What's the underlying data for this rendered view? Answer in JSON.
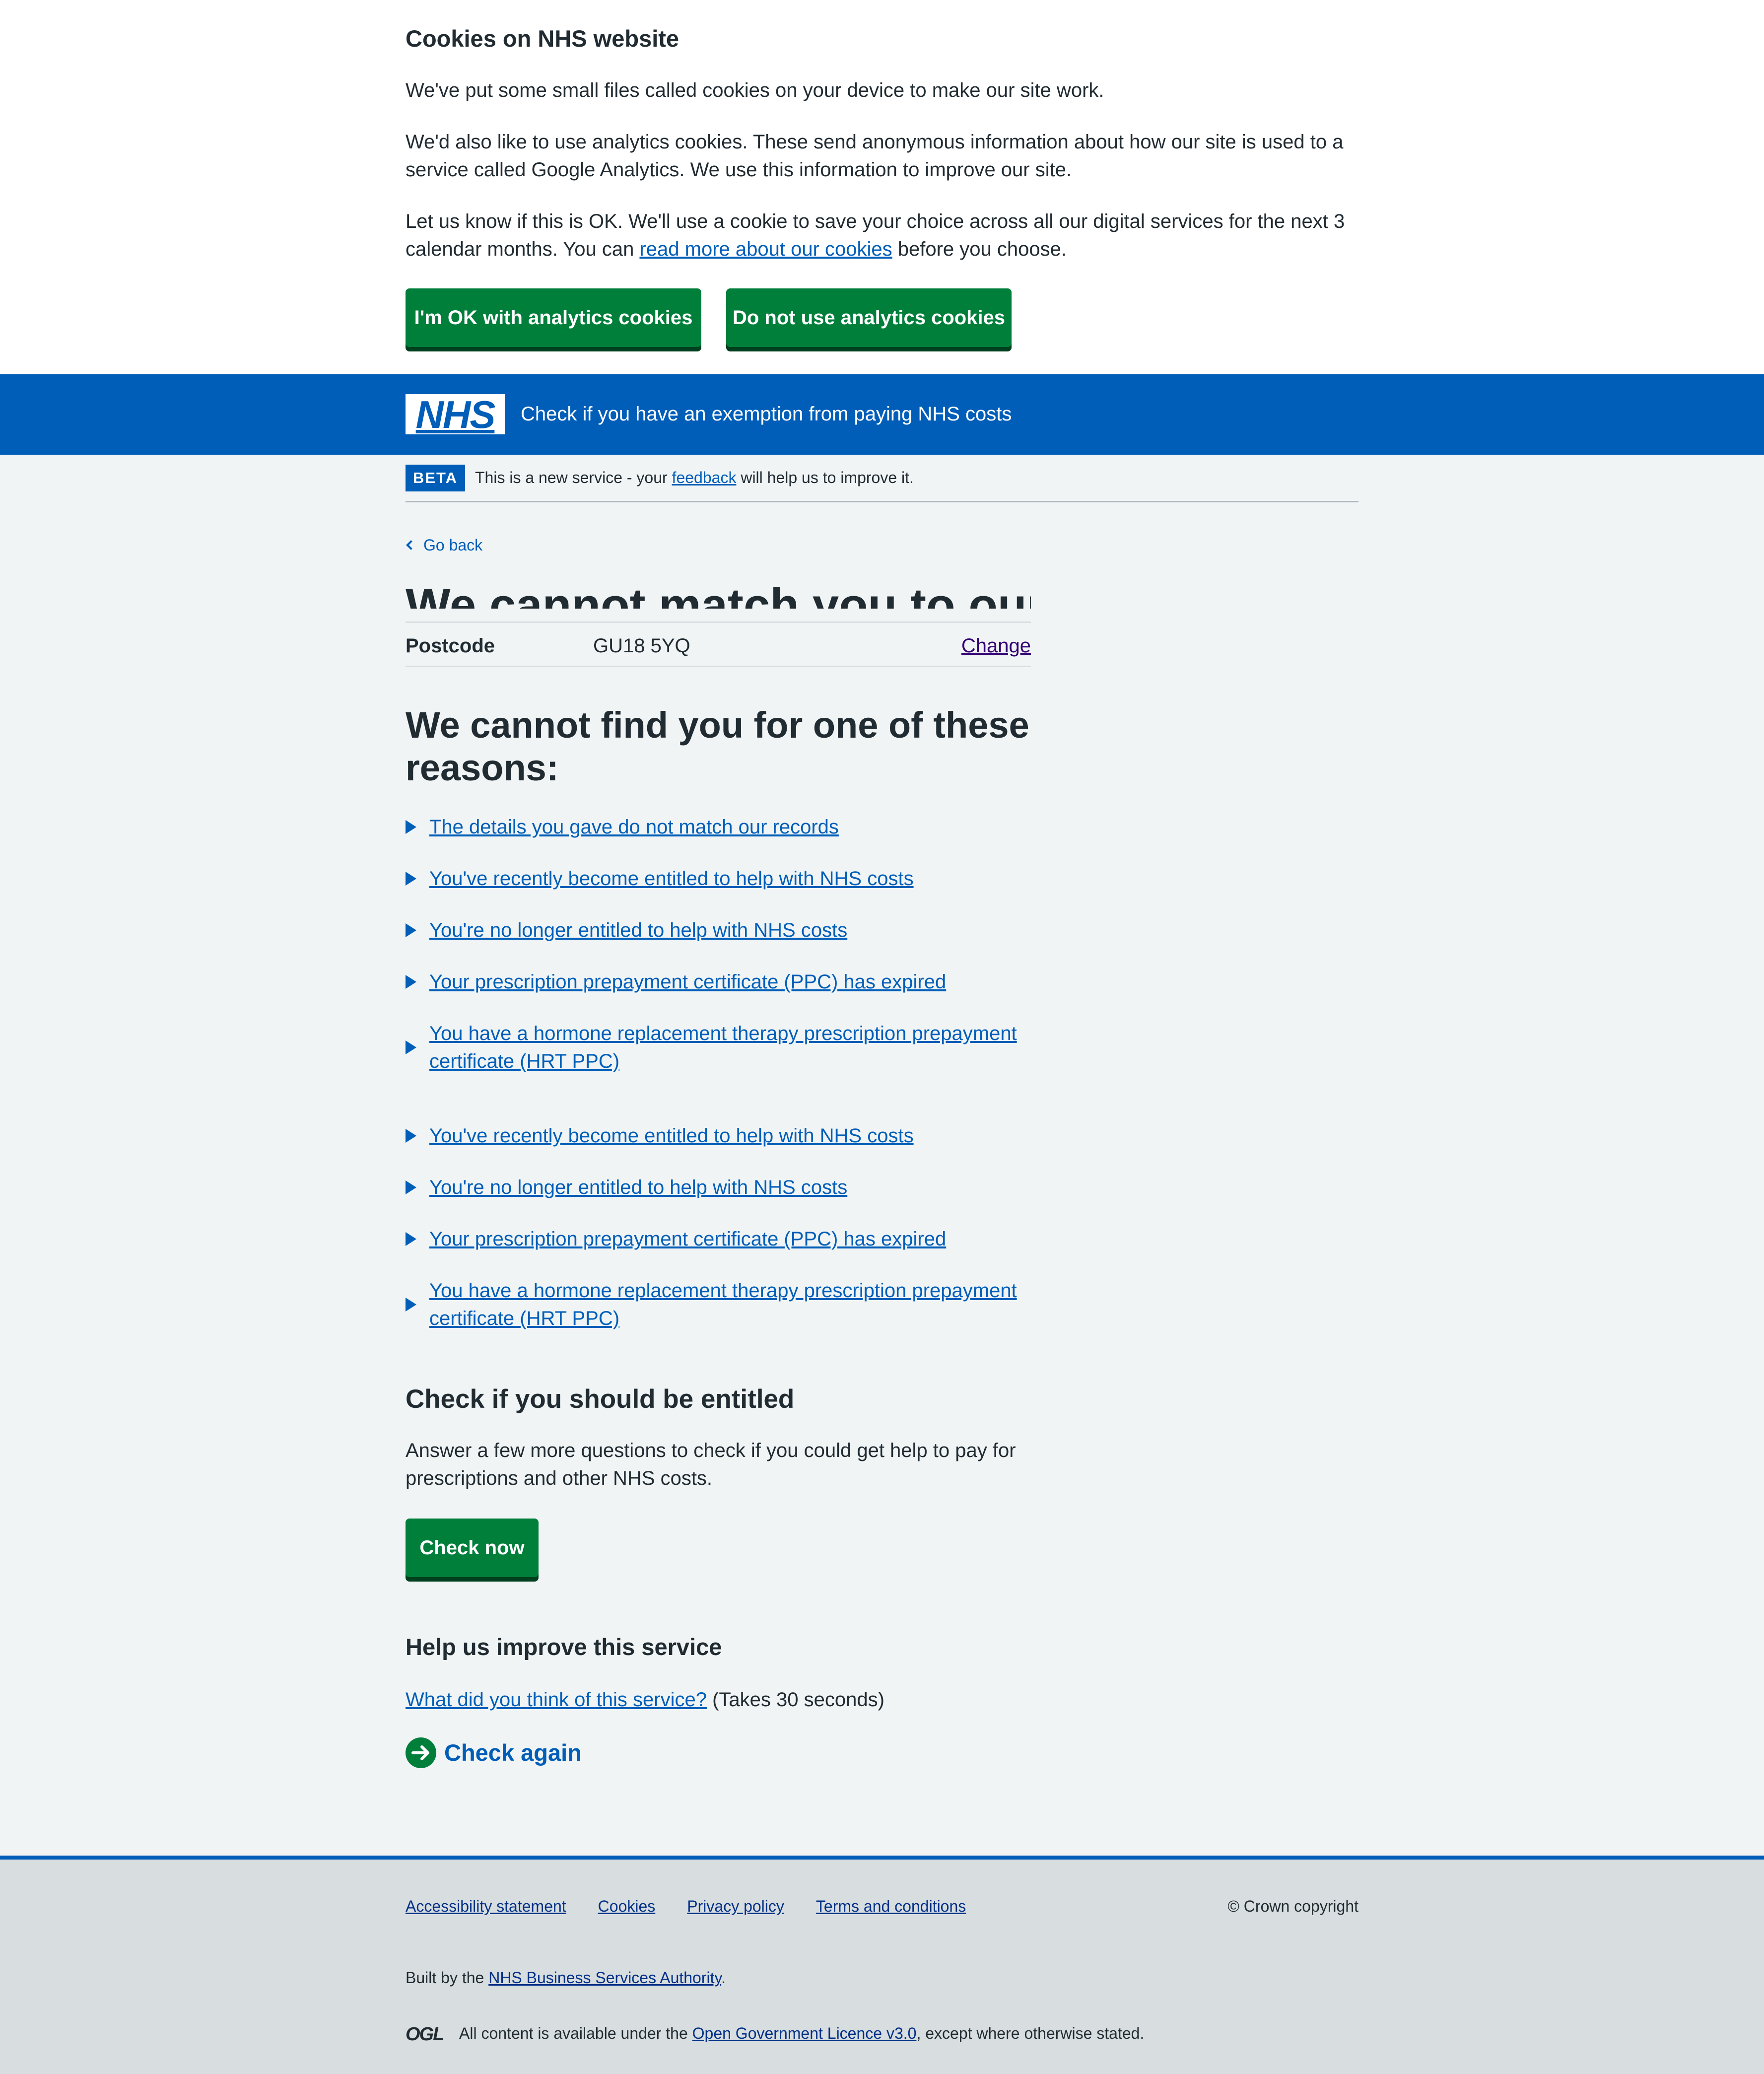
{
  "cookie_banner": {
    "title": "Cookies on NHS website",
    "p1": "We've put some small files called cookies on your device to make our site work.",
    "p2": "We'd also like to use analytics cookies. These send anonymous information about how our site is used to a service called Google Analytics. We use this information to improve our site.",
    "p3_before": "Let us know if this is OK. We'll use a cookie to save your choice across all our digital services for the next 3 calendar months. You can ",
    "p3_link": "read more about our cookies",
    "p3_after": " before you choose.",
    "accept_label": "I'm OK with analytics cookies",
    "reject_label": "Do not use analytics cookies"
  },
  "header": {
    "logo_text": "NHS",
    "service_name": "Check if you have an exemption from paying NHS costs"
  },
  "beta": {
    "tag": "BETA",
    "text_before": "This is a new service - your ",
    "link": "feedback",
    "text_after": " will help us to improve it."
  },
  "back_link": "Go back",
  "heading_cropped": "We cannot match you to our records",
  "summary": {
    "key": "Postcode",
    "value": "GU18 5YQ",
    "action": "Change"
  },
  "reasons_heading": "We cannot find you for one of these reasons:",
  "reasons": [
    "The details you gave do not match our records",
    "You've recently become entitled to help with NHS costs",
    "You're no longer entitled to help with NHS costs",
    "Your prescription prepayment certificate (PPC) has expired",
    "You have a hormone replacement therapy prescription prepayment certificate (HRT PPC)",
    "You've recently become entitled to help with NHS costs",
    "You're no longer entitled to help with NHS costs",
    "Your prescription prepayment certificate (PPC) has expired",
    "You have a hormone replacement therapy prescription prepayment certificate (HRT PPC)"
  ],
  "entitled": {
    "heading": "Check if you should be entitled",
    "text": "Answer a few more questions to check if you could get help to pay for prescriptions and other NHS costs.",
    "button": "Check now"
  },
  "improve": {
    "heading": "Help us improve this service",
    "link": "What did you think of this service?",
    "suffix": " (Takes 30 seconds)"
  },
  "check_again": "Check again",
  "footer": {
    "links": [
      "Accessibility statement",
      "Cookies",
      "Privacy policy",
      "Terms and conditions"
    ],
    "copyright": "© Crown copyright",
    "built_before": "Built by the ",
    "built_link": "NHS Business Services Authority",
    "built_after": ".",
    "ogl_logo": "OGL",
    "licence_before": "All content is available under the ",
    "licence_link": "Open Government Licence v3.0",
    "licence_after": ", except where otherwise stated."
  },
  "colors": {
    "nhs_blue": "#005eb8",
    "button_green": "#007f3b",
    "page_bg": "#f0f4f5",
    "footer_bg": "#d8dde0"
  }
}
